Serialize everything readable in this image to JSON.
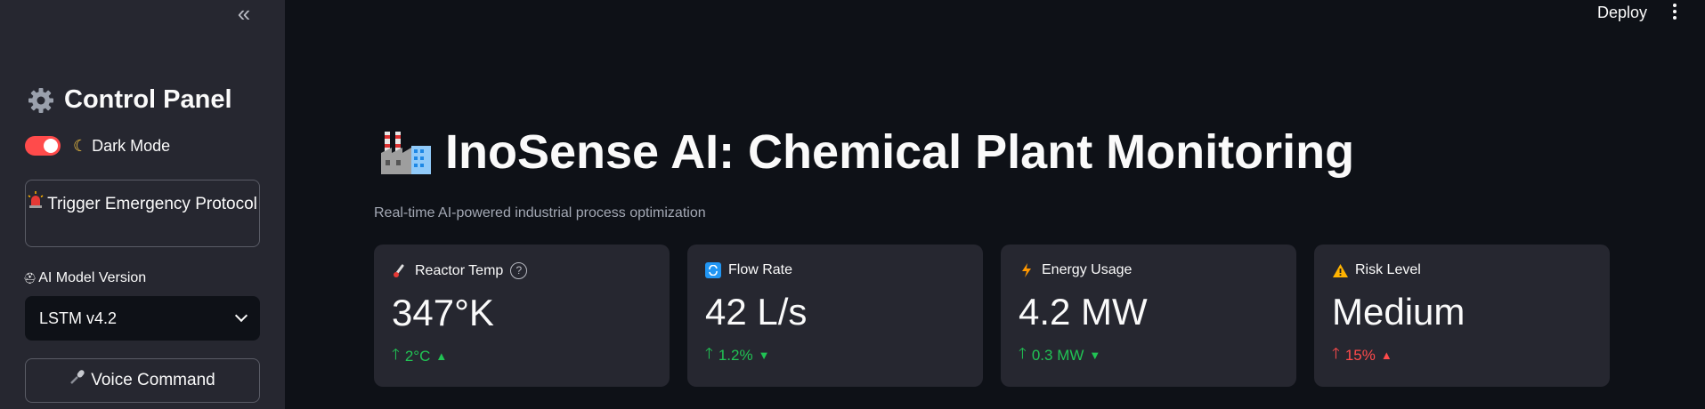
{
  "sidebar": {
    "collapse_symbol": "«",
    "panel_title": "Control Panel",
    "dark_mode_label": "Dark Mode",
    "dark_mode_on": true,
    "emergency_button": "Trigger Emergency Protocol",
    "model_label": "AI Model Version",
    "model_selected": "LSTM v4.2",
    "voice_button": "Voice Command"
  },
  "header": {
    "deploy_label": "Deploy"
  },
  "main": {
    "title": "InoSense AI: Chemical Plant Monitoring",
    "subtitle": "Real-time AI-powered industrial process optimization",
    "metrics": [
      {
        "label": "Reactor Temp",
        "icon": "thermometer-icon",
        "value": "347°K",
        "delta": "2°C",
        "delta_color": "#21c354",
        "trend": "▲",
        "help": "?"
      },
      {
        "label": "Flow Rate",
        "icon": "repeat-icon",
        "value": "42 L/s",
        "delta": "1.2%",
        "delta_color": "#21c354",
        "trend": "▼"
      },
      {
        "label": "Energy Usage",
        "icon": "lightning-icon",
        "value": "4.2 MW",
        "delta": "0.3 MW",
        "delta_color": "#21c354",
        "trend": "▼"
      },
      {
        "label": "Risk Level",
        "icon": "warning-icon",
        "value": "Medium",
        "delta": "15%",
        "delta_color": "#ff4b4b",
        "trend": "▲"
      }
    ]
  },
  "colors": {
    "background": "#0e1117",
    "sidebar": "#262730",
    "accent": "#ff4b4b",
    "positive": "#21c354"
  }
}
